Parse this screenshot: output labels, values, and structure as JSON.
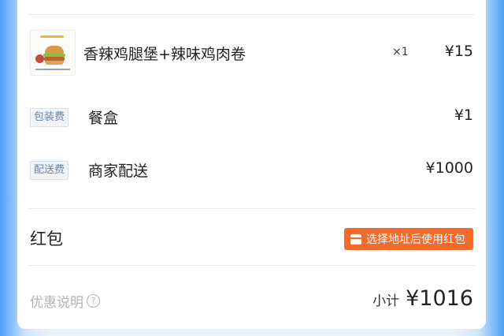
{
  "order_item": {
    "name": "香辣鸡腿堡+辣味鸡肉卷",
    "quantity": "×1",
    "price": "¥15",
    "thumbnail_icon": "burger-image"
  },
  "fees": [
    {
      "tag": "包装费",
      "label": "餐盒",
      "value": "¥1"
    },
    {
      "tag": "配送费",
      "label": "商家配送",
      "value": "¥1000"
    }
  ],
  "red_packet": {
    "title": "红包",
    "button_label": "选择地址后使用红包",
    "button_color": "#f26a2c",
    "button_icon": "red-packet-icon"
  },
  "footer": {
    "promo_label": "优惠说明",
    "help_icon": "?",
    "subtotal_label": "小计",
    "subtotal_value": "¥1016"
  }
}
